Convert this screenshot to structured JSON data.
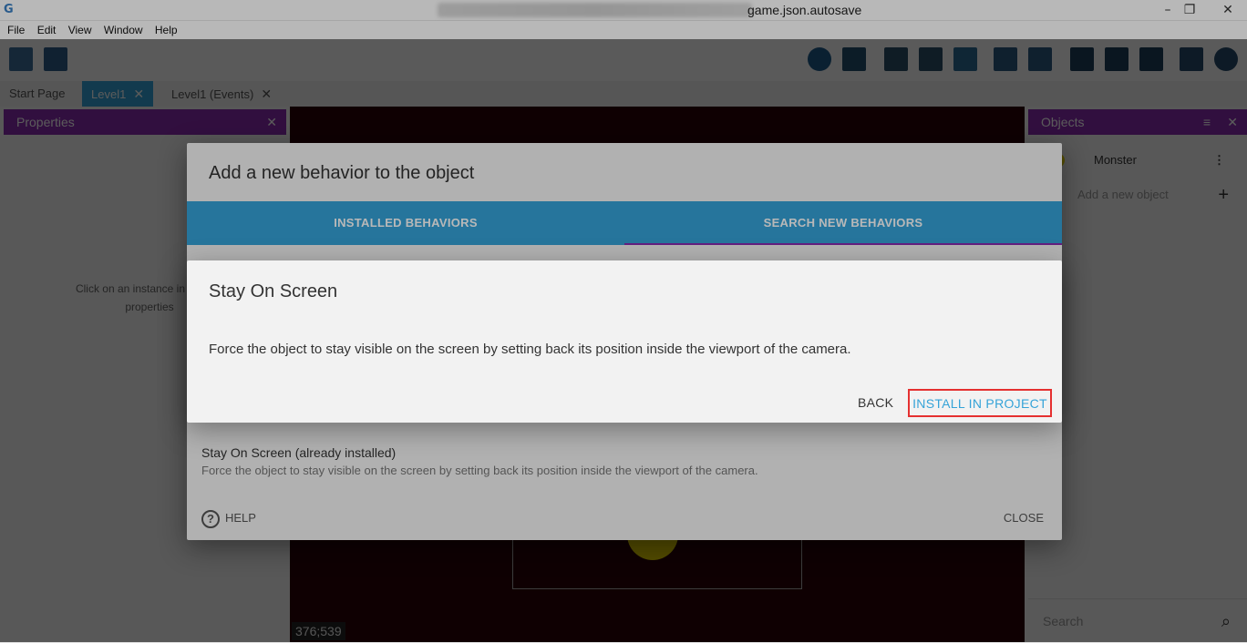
{
  "window": {
    "title": "game.json.autosave",
    "controls": [
      "–",
      "❐",
      "✕"
    ]
  },
  "menu": [
    "File",
    "Edit",
    "View",
    "Window",
    "Help"
  ],
  "tabs": [
    {
      "label": "Start Page"
    },
    {
      "label": "Level1",
      "active": true
    },
    {
      "label": "Level1 (Events)"
    }
  ],
  "properties_panel": {
    "title": "Properties",
    "hint_line1": "Click on an instance in the sce",
    "hint_line2": "properties"
  },
  "canvas": {
    "coords": "376;539"
  },
  "objects_panel": {
    "title": "Objects",
    "object_name": "Monster",
    "add_label": "Add a new object",
    "search_placeholder": "Search"
  },
  "behavior_dialog": {
    "title": "Add a new behavior to the object",
    "tab_installed": "INSTALLED BEHAVIORS",
    "tab_search": "SEARCH NEW BEHAVIORS",
    "result_name": "Stay On Screen (already installed)",
    "result_desc": "Force the object to stay visible on the screen by setting back its position inside the viewport of the camera.",
    "help_label": "HELP",
    "close_label": "CLOSE"
  },
  "detail_dialog": {
    "title": "Stay On Screen",
    "description": "Force the object to stay visible on the screen by setting back its position inside the viewport of the camera.",
    "back_label": "BACK",
    "install_label": "INSTALL IN PROJECT"
  },
  "colors": {
    "accent": "#35a3d8",
    "panel_header": "#8a2bb0",
    "highlight_border": "#e53030"
  }
}
